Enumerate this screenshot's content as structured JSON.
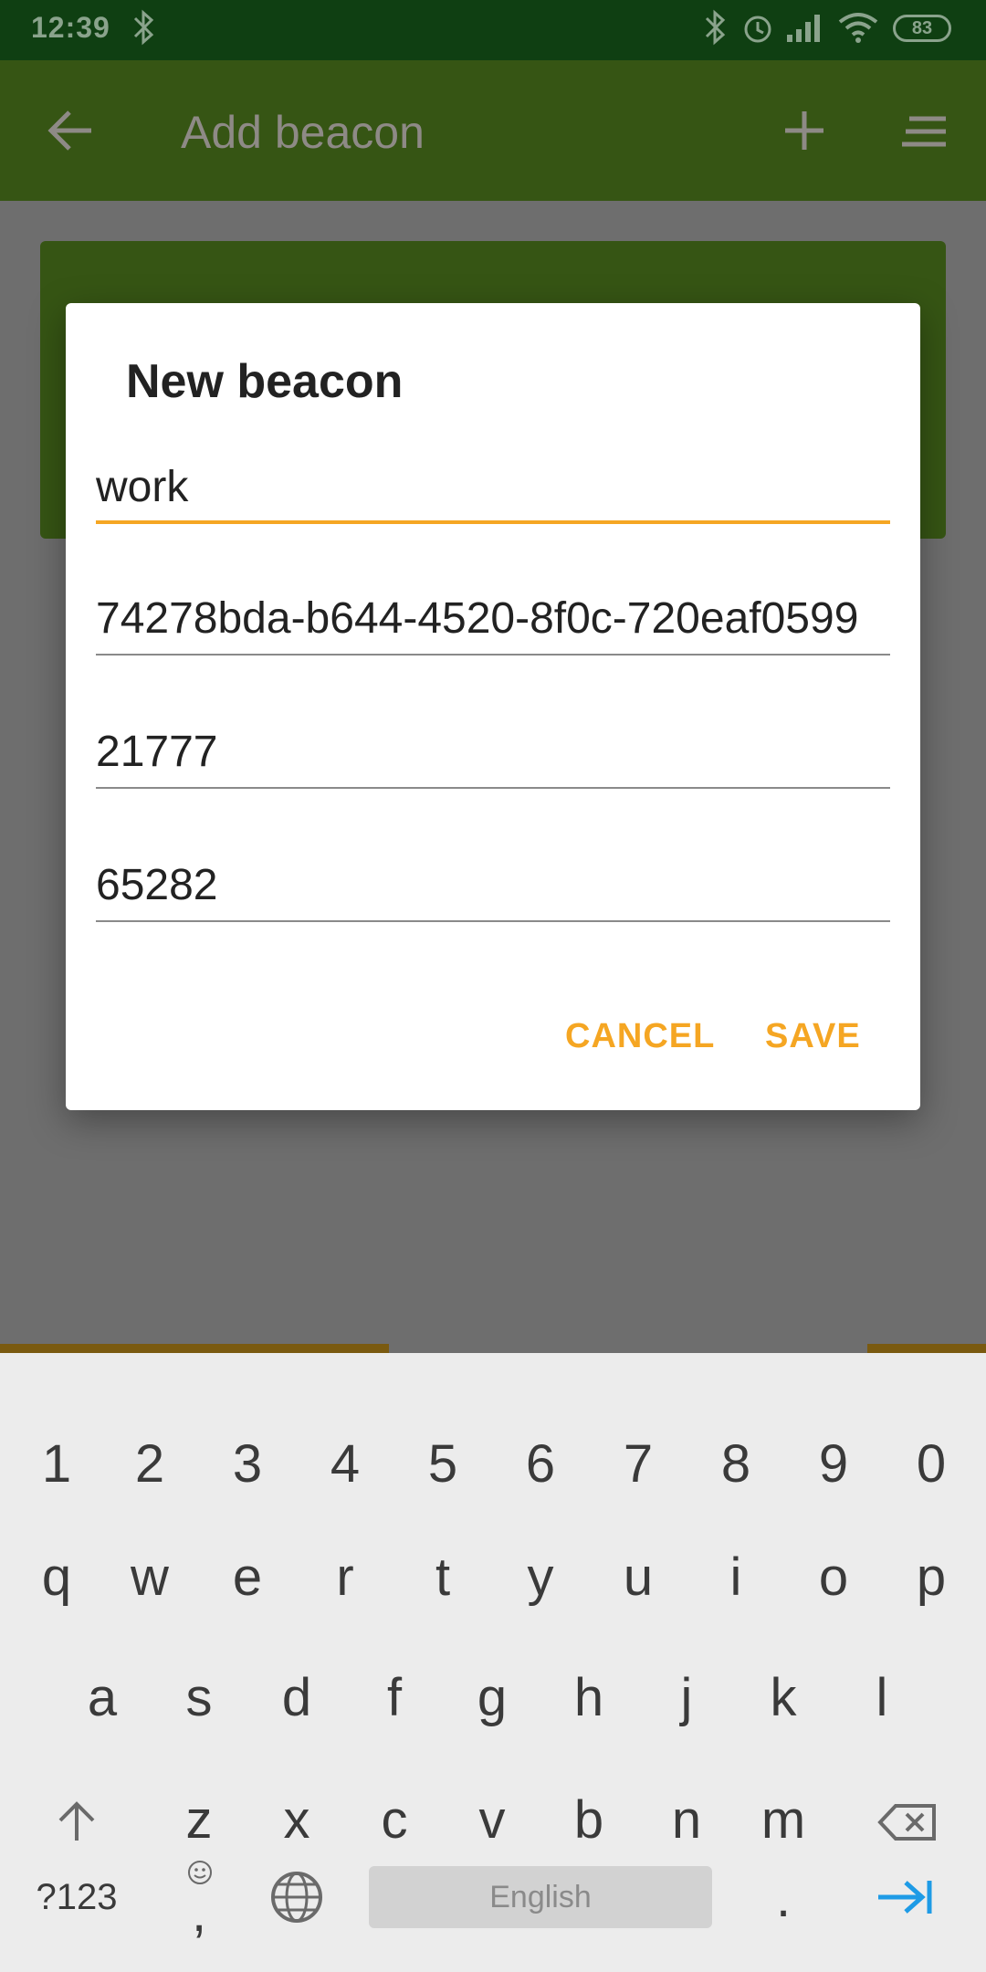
{
  "status_bar": {
    "time": "12:39",
    "battery": "83",
    "icons": [
      "bluetooth-icon",
      "alarm-icon",
      "signal-icon",
      "wifi-icon"
    ]
  },
  "app_bar": {
    "title": "Add beacon",
    "back_icon": "arrow-left-icon",
    "add_icon": "plus-icon",
    "menu_icon": "sort-icon"
  },
  "dialog": {
    "title": "New beacon",
    "fields": {
      "name": "work",
      "uuid": "74278bda-b644-4520-8f0c-720eaf0599",
      "major": "21777",
      "minor": "65282"
    },
    "cancel_label": "CANCEL",
    "save_label": "SAVE"
  },
  "keyboard": {
    "row_numbers": [
      "1",
      "2",
      "3",
      "4",
      "5",
      "6",
      "7",
      "8",
      "9",
      "0"
    ],
    "row_1": [
      "q",
      "w",
      "e",
      "r",
      "t",
      "y",
      "u",
      "i",
      "o",
      "p"
    ],
    "row_2": [
      "a",
      "s",
      "d",
      "f",
      "g",
      "h",
      "j",
      "k",
      "l"
    ],
    "row_3": [
      "z",
      "x",
      "c",
      "v",
      "b",
      "n",
      "m"
    ],
    "symbols_label": "?123",
    "comma_label": ",",
    "space_label": "English",
    "period_label": "."
  },
  "colors": {
    "accent": "#f5a623",
    "app_bar": "#365514",
    "status_bar": "#0f3f12"
  }
}
